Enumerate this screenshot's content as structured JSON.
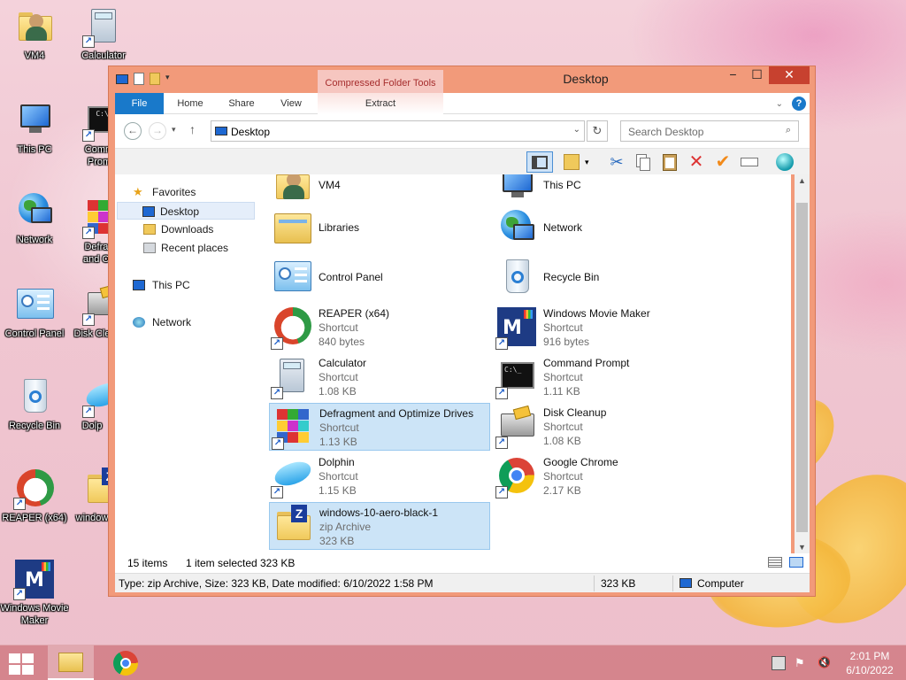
{
  "desktop": {
    "icons": [
      {
        "label": "VM4"
      },
      {
        "label": "Calculator"
      },
      {
        "label": "This PC"
      },
      {
        "label": "Comm Prom"
      },
      {
        "label": "Network"
      },
      {
        "label": "Defrag and Op"
      },
      {
        "label": "Control Panel"
      },
      {
        "label": "Disk Cle"
      },
      {
        "label": "Recycle Bin"
      },
      {
        "label": "Dolp"
      },
      {
        "label": "REAPER (x64)"
      },
      {
        "label": "window"
      },
      {
        "label": "Windows Movie Maker"
      }
    ]
  },
  "window": {
    "title": "Desktop",
    "contextual_tab": "Compressed Folder Tools",
    "ribbon_tabs": [
      "File",
      "Home",
      "Share",
      "View",
      "Extract"
    ],
    "controls": {
      "minimize": "−",
      "maximize": "☐",
      "close": "✕"
    },
    "help": "?",
    "address": {
      "location": "Desktop"
    },
    "search": {
      "placeholder": "Search Desktop"
    }
  },
  "navpane": {
    "favorites": "Favorites",
    "desktop": "Desktop",
    "downloads": "Downloads",
    "recent": "Recent places",
    "thispc": "This PC",
    "network": "Network"
  },
  "files": [
    {
      "name": "VM4",
      "type": "",
      "size": ""
    },
    {
      "name": "This PC",
      "type": "",
      "size": ""
    },
    {
      "name": "Libraries",
      "type": "",
      "size": ""
    },
    {
      "name": "Network",
      "type": "",
      "size": ""
    },
    {
      "name": "Control Panel",
      "type": "",
      "size": ""
    },
    {
      "name": "Recycle Bin",
      "type": "",
      "size": ""
    },
    {
      "name": "REAPER (x64)",
      "type": "Shortcut",
      "size": "840 bytes"
    },
    {
      "name": "Windows Movie Maker",
      "type": "Shortcut",
      "size": "916 bytes"
    },
    {
      "name": "Calculator",
      "type": "Shortcut",
      "size": "1.08 KB"
    },
    {
      "name": "Command Prompt",
      "type": "Shortcut",
      "size": "1.11 KB"
    },
    {
      "name": "Defragment and Optimize Drives",
      "type": "Shortcut",
      "size": "1.13 KB"
    },
    {
      "name": "Disk Cleanup",
      "type": "Shortcut",
      "size": "1.08 KB"
    },
    {
      "name": "Dolphin",
      "type": "Shortcut",
      "size": "1.15 KB"
    },
    {
      "name": "Google Chrome",
      "type": "Shortcut",
      "size": "2.17 KB"
    },
    {
      "name": "windows-10-aero-black-1",
      "type": "zip Archive",
      "size": "323 KB"
    }
  ],
  "status": {
    "count": "15 items",
    "selected": "1 item selected",
    "selected_size": "323 KB"
  },
  "details_bar": {
    "info": "Type: zip Archive, Size: 323 KB, Date modified: 6/10/2022 1:58 PM",
    "size": "323 KB",
    "location": "Computer"
  },
  "taskbar": {
    "time": "2:01 PM",
    "date": "6/10/2022"
  },
  "colors": {
    "window_frame": "#f29a7a",
    "close_button": "#c7412f",
    "file_tab": "#1979ca",
    "selection": "#cce4f7"
  }
}
